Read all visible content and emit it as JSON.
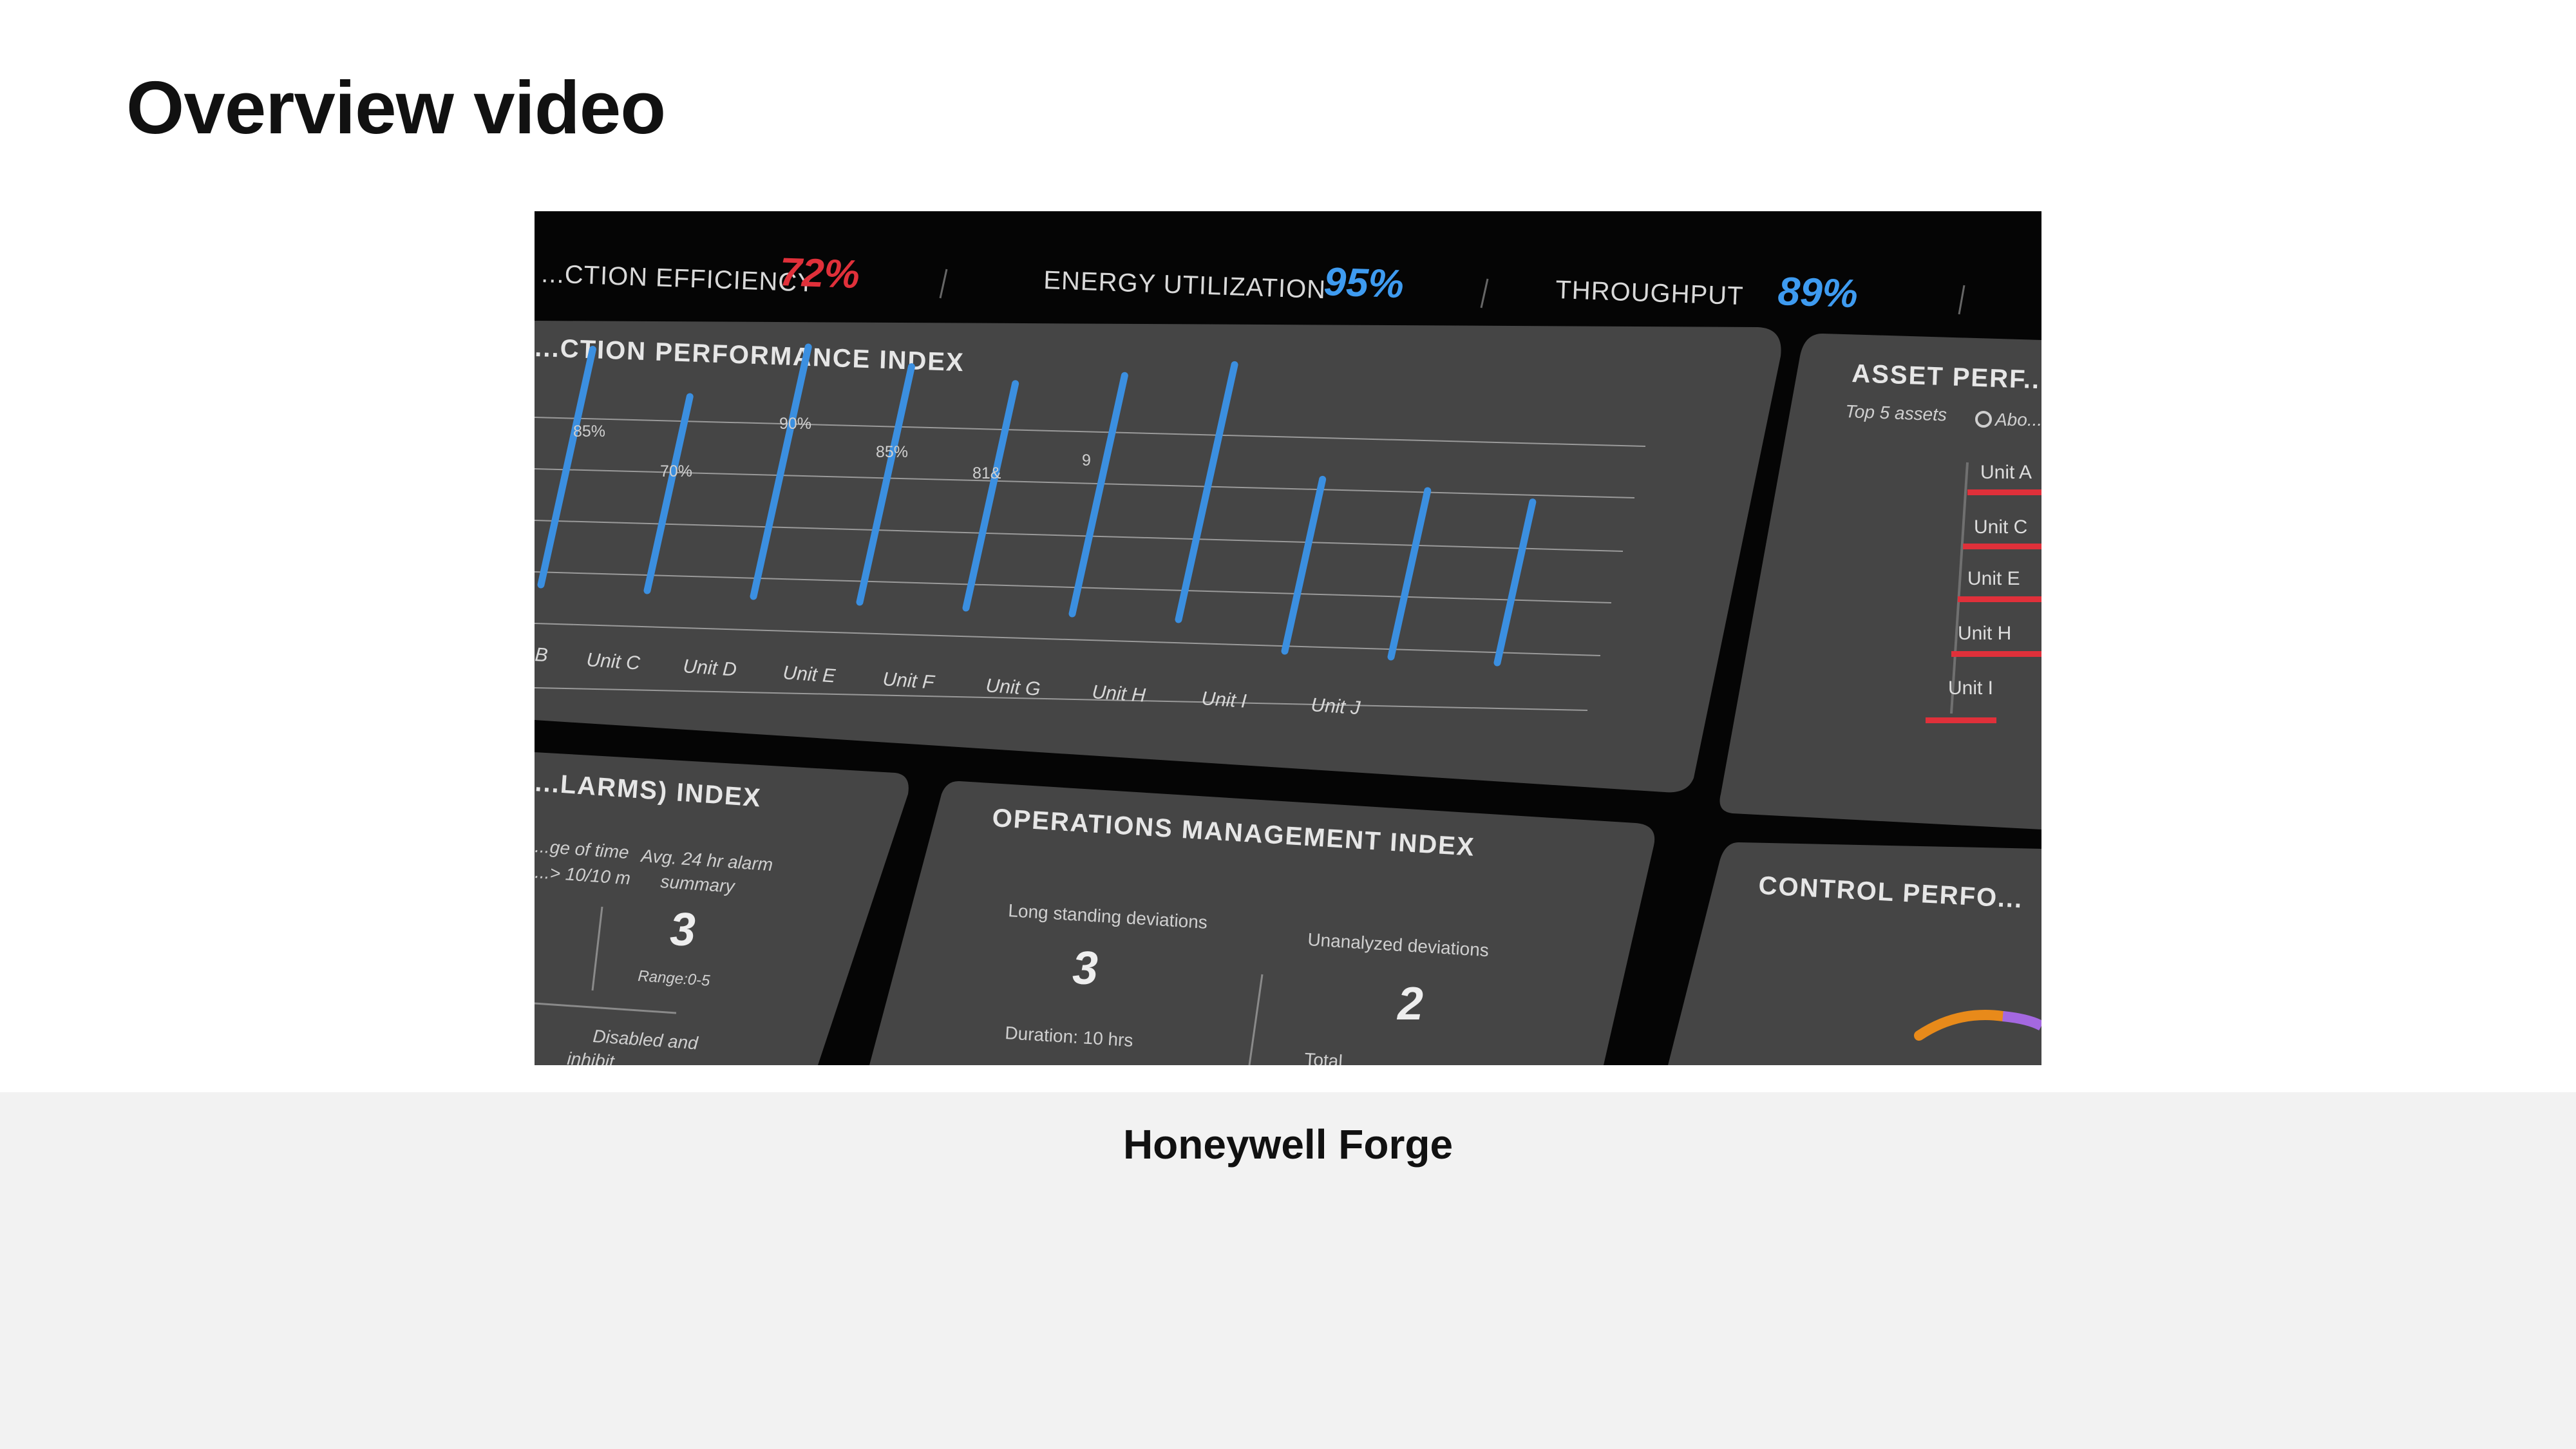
{
  "page": {
    "title": "Overview video",
    "caption": "Honeywell Forge"
  },
  "video": {
    "kpis": [
      {
        "label": "...CTION EFFICIENCY",
        "value": "72%",
        "color": "#e0303a"
      },
      {
        "label": "ENERGY UTILIZATION",
        "value": "95%",
        "color": "#3e9bf0"
      },
      {
        "label": "THROUGHPUT",
        "value": "89%",
        "color": "#3e9bf0"
      }
    ],
    "performance_panel": {
      "title": "...CTION PERFORMANCE INDEX",
      "units": [
        "B",
        "Unit C",
        "Unit D",
        "Unit E",
        "Unit F",
        "Unit G",
        "Unit H",
        "Unit I",
        "Unit J"
      ],
      "bar_labels": [
        "85%",
        "70%",
        "90%",
        "85%",
        "81&",
        "9"
      ],
      "bar_values": [
        0.85,
        0.7,
        0.9,
        0.85,
        0.81,
        0.86,
        0.92,
        0.62,
        0.6,
        0.58
      ],
      "bar_color": "#3b8fe0"
    },
    "asset_panel": {
      "title": "ASSET PERF...",
      "subtitle": "Top 5 assets",
      "option": "Abo...",
      "units": [
        "Unit A",
        "Unit C",
        "Unit E",
        "Unit H",
        "Unit I"
      ],
      "accent": "#e0303a"
    },
    "alarms_panel": {
      "title": "...LARMS) INDEX",
      "left_label_1": "...ge of time",
      "left_label_2": "...> 10/10 m",
      "col_label_1": "Avg. 24 hr alarm",
      "col_label_2": "summary",
      "value": "3",
      "range": "Range:0-5",
      "footer": "Disabled and",
      "footer_2": "inhibit..."
    },
    "operations_panel": {
      "title": "OPERATIONS MANAGEMENT INDEX",
      "metric_1_label": "Long standing deviations",
      "metric_1_value": "3",
      "metric_1_sub": "Duration: 10 hrs",
      "metric_2_label": "Unanalyzed deviations",
      "metric_2_value": "2",
      "metric_2_sub": "Total..."
    },
    "control_panel": {
      "title": "CONTROL PERFO...",
      "arc_colors": [
        "#e88a1a",
        "#a468e0"
      ]
    }
  }
}
